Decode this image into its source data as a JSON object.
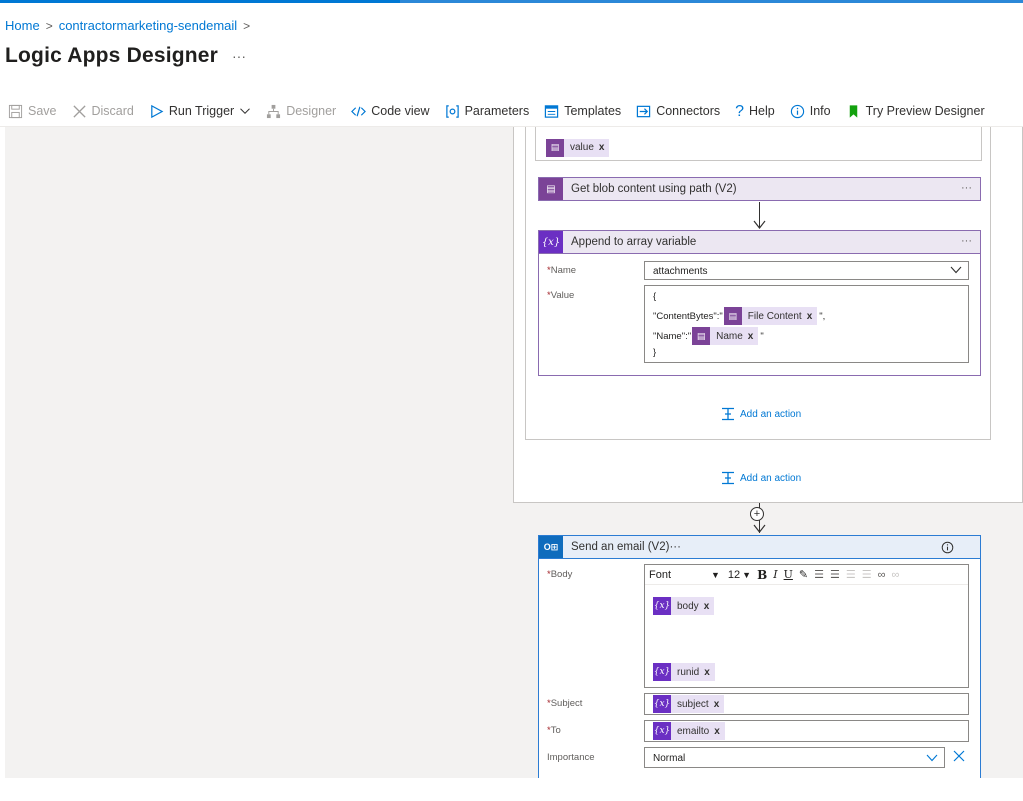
{
  "breadcrumb": {
    "home": "Home",
    "separator": ">",
    "resource": "contractormarketing-sendemail"
  },
  "page": {
    "title": "Logic Apps Designer",
    "more": "···"
  },
  "toolbar": {
    "save": "Save",
    "discard": "Discard",
    "run_trigger": "Run Trigger",
    "designer": "Designer",
    "code_view": "Code view",
    "parameters": "Parameters",
    "templates": "Templates",
    "connectors": "Connectors",
    "help": "Help",
    "info": "Info",
    "try_preview": "Try Preview Designer"
  },
  "flow": {
    "value_token": "value",
    "get_blob": {
      "title": "Get blob content using path (V2)",
      "more": "···"
    },
    "append": {
      "title": "Append to array variable",
      "more": "···",
      "name_label": "Name",
      "name_value": "attachments",
      "value_label": "Value",
      "json_open": "{",
      "content_bytes_key": "\"ContentBytes\":\"",
      "content_bytes_token": "File Content",
      "content_bytes_end": "\",",
      "name_key": "\"Name\":\"",
      "name_token": "Name",
      "name_end": "\"",
      "json_close": "}"
    },
    "add_action_inner": "Add an action",
    "add_action_outer": "Add an action",
    "send_email": {
      "title": "Send an email (V2)",
      "more": "···",
      "body_label": "Body",
      "font": "Font",
      "font_size": "12",
      "body_token_1": "body",
      "body_token_2": "runid",
      "subject_label": "Subject",
      "subject_token": "subject",
      "to_label": "To",
      "to_token": "emailto",
      "importance_label": "Importance",
      "importance_value": "Normal"
    }
  },
  "token_icons": {
    "blob": "blob-icon",
    "variable": "{x}"
  },
  "colors": {
    "accent": "#0078d4",
    "variable_purple": "#6b2fc3",
    "blob_purple": "#7b4397",
    "outlook_blue": "#0f6cbd",
    "required": "#a4262c"
  }
}
